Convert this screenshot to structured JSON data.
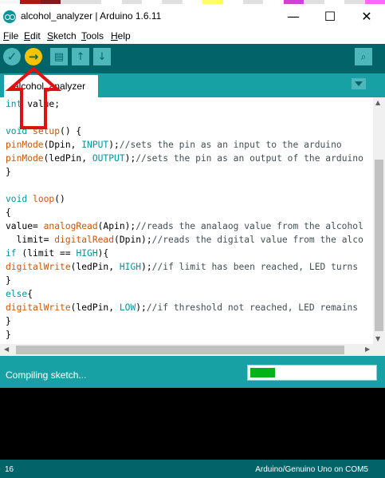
{
  "window": {
    "title": "alcohol_analyzer | Arduino 1.6.11",
    "controls": {
      "minimize": "—",
      "maximize": "☐",
      "close": "✕"
    }
  },
  "palette_colors": [
    "#f7f7f7",
    "#ad1519",
    "#7d1b1b",
    "#e0e0e0",
    "#e0e0e0",
    "#ffffff",
    "#e0e0e0",
    "#ffffff",
    "#e0e0e0",
    "#ffffff",
    "#ffff66",
    "#ffffff",
    "#e0e0e0",
    "#ffffff",
    "#cc44cc",
    "#e0e0e0",
    "#ffffff",
    "#e0e0e0",
    "#ff66ff"
  ],
  "menu": {
    "items": [
      {
        "key": "F",
        "rest": "ile"
      },
      {
        "key": "E",
        "rest": "dit"
      },
      {
        "key": "S",
        "rest": "ketch"
      },
      {
        "key": "T",
        "rest": "ools"
      },
      {
        "key": "H",
        "rest": "elp"
      }
    ]
  },
  "toolbar": {
    "verify_icon": "✓",
    "upload_icon": "→",
    "new_icon": "▤",
    "open_icon": "↑",
    "save_icon": "↓",
    "serial_icon": "⌕"
  },
  "tab": {
    "label": "alcohol_analyzer"
  },
  "code_lines": [
    [
      {
        "t": "int ",
        "c": "kw"
      },
      {
        "t": "value;",
        "c": ""
      }
    ],
    [],
    [
      {
        "t": "void ",
        "c": "kw"
      },
      {
        "t": "setup",
        "c": "fn"
      },
      {
        "t": "() {",
        "c": ""
      }
    ],
    [
      {
        "t": "pinMode",
        "c": "fn"
      },
      {
        "t": "(Dpin, ",
        "c": ""
      },
      {
        "t": "INPUT",
        "c": "kw"
      },
      {
        "t": ");",
        "c": ""
      },
      {
        "t": "//sets the pin as an input to the arduino",
        "c": "ct"
      }
    ],
    [
      {
        "t": "pinMode",
        "c": "fn"
      },
      {
        "t": "(ledPin, ",
        "c": ""
      },
      {
        "t": "OUTPUT",
        "c": "kw"
      },
      {
        "t": ");",
        "c": ""
      },
      {
        "t": "//sets the pin as an output of the arduino",
        "c": "ct"
      }
    ],
    [
      {
        "t": "}",
        "c": ""
      }
    ],
    [],
    [
      {
        "t": "void ",
        "c": "kw"
      },
      {
        "t": "loop",
        "c": "fn"
      },
      {
        "t": "()",
        "c": ""
      }
    ],
    [
      {
        "t": "{",
        "c": ""
      }
    ],
    [
      {
        "t": "value= ",
        "c": ""
      },
      {
        "t": "analogRead",
        "c": "fn"
      },
      {
        "t": "(Apin);",
        "c": ""
      },
      {
        "t": "//reads the analaog value from the alcohol",
        "c": "ct"
      }
    ],
    [
      {
        "t": "  limit= ",
        "c": ""
      },
      {
        "t": "digitalRead",
        "c": "fn"
      },
      {
        "t": "(Dpin);",
        "c": ""
      },
      {
        "t": "//reads the digital value from the alco",
        "c": "ct"
      }
    ],
    [
      {
        "t": "if",
        "c": "kw"
      },
      {
        "t": " (limit == ",
        "c": ""
      },
      {
        "t": "HIGH",
        "c": "kw"
      },
      {
        "t": "){",
        "c": ""
      }
    ],
    [
      {
        "t": "digitalWrite",
        "c": "fn"
      },
      {
        "t": "(ledPin, ",
        "c": ""
      },
      {
        "t": "HIGH",
        "c": "kw"
      },
      {
        "t": ");",
        "c": ""
      },
      {
        "t": "//if limit has been reached, LED turns",
        "c": "ct"
      }
    ],
    [
      {
        "t": "}",
        "c": ""
      }
    ],
    [
      {
        "t": "else",
        "c": "kw"
      },
      {
        "t": "{",
        "c": ""
      }
    ],
    [
      {
        "t": "digitalWrite",
        "c": "fn"
      },
      {
        "t": "(ledPin, ",
        "c": ""
      },
      {
        "t": "LOW",
        "c": "kw"
      },
      {
        "t": ");",
        "c": ""
      },
      {
        "t": "//if threshold not reached, LED remains",
        "c": "ct"
      }
    ],
    [
      {
        "t": "}",
        "c": ""
      }
    ],
    [
      {
        "t": "}",
        "c": ""
      }
    ]
  ],
  "status": {
    "message": "Compiling sketch...",
    "progress_fraction": 0.2
  },
  "footer": {
    "line_number": "16",
    "board": "Arduino/Genuino Uno on COM5"
  },
  "annotation": {
    "color": "#e01010",
    "shape": "up-arrow-outline"
  }
}
